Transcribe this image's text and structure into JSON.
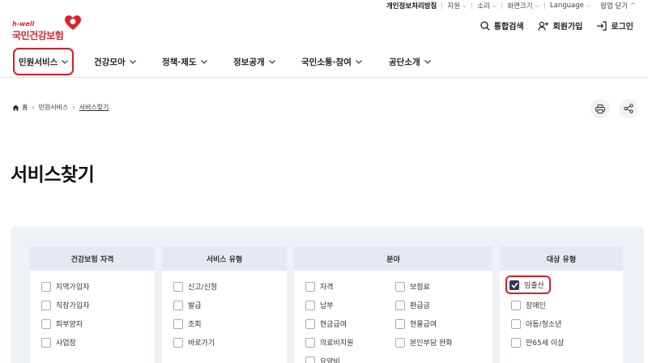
{
  "utility": {
    "privacy": "개인정보처리방침",
    "support": "지원",
    "sound": "소리",
    "screen_size": "화면크기",
    "language": "Language",
    "popup_close": "팝업 닫기"
  },
  "logo": {
    "tag": "h-well",
    "name": "국민건강보험"
  },
  "actions": {
    "search": "통합검색",
    "signup": "회원가입",
    "login": "로그인"
  },
  "gnb": [
    "민원서비스",
    "건강모아",
    "정책·제도",
    "정보공개",
    "국민소통·참여",
    "공단소개"
  ],
  "breadcrumb": {
    "home": "홈",
    "level1": "민원서비스",
    "current": "서비스찾기"
  },
  "page_title": "서비스찾기",
  "filters": {
    "qualification": {
      "title": "건강보험 자격",
      "items": [
        "지역가입자",
        "직장가입자",
        "피부양자",
        "사업장"
      ]
    },
    "service_type": {
      "title": "서비스 유형",
      "items": [
        "신고/신청",
        "발급",
        "조회",
        "바로가기"
      ]
    },
    "field": {
      "title": "분야",
      "items": [
        "자격",
        "보험료",
        "납부",
        "환급금",
        "현금급여",
        "현물급여",
        "의료비지원",
        "본인부담 완화",
        "요양비"
      ]
    },
    "target": {
      "title": "대상 유형",
      "items": [
        "임출산",
        "장애인",
        "아동/청소년",
        "만65세 이상"
      ],
      "checked": "임출산"
    }
  },
  "colors": {
    "brand": "#d9232d",
    "highlight": "#d0202a",
    "panel": "#eef1f6",
    "header": "#e4e9f2",
    "checked": "#2d3a5a"
  }
}
